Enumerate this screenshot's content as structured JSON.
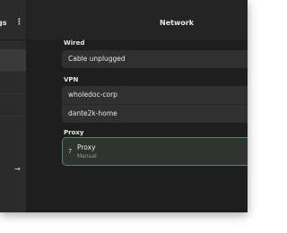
{
  "sidebar": {
    "title": "gs",
    "menu_icon": "vertical-ellipsis-icon",
    "menu_glyph": "⋮",
    "arrow_icon": "arrow-right-icon",
    "arrow_glyph": "→"
  },
  "header": {
    "title": "Network"
  },
  "sections": {
    "wired": {
      "label": "Wired",
      "rows": [
        "Cable unplugged"
      ]
    },
    "vpn": {
      "label": "VPN",
      "rows": [
        "wholedoc-corp",
        "dante2k-home"
      ]
    },
    "proxy": {
      "label": "Proxy",
      "icon": "network-proxy-icon",
      "glyph": "⁊",
      "title": "Proxy",
      "subtitle": "Manual"
    }
  },
  "colors": {
    "window_bg": "#242424",
    "accent_border": "#4f8a5b"
  }
}
